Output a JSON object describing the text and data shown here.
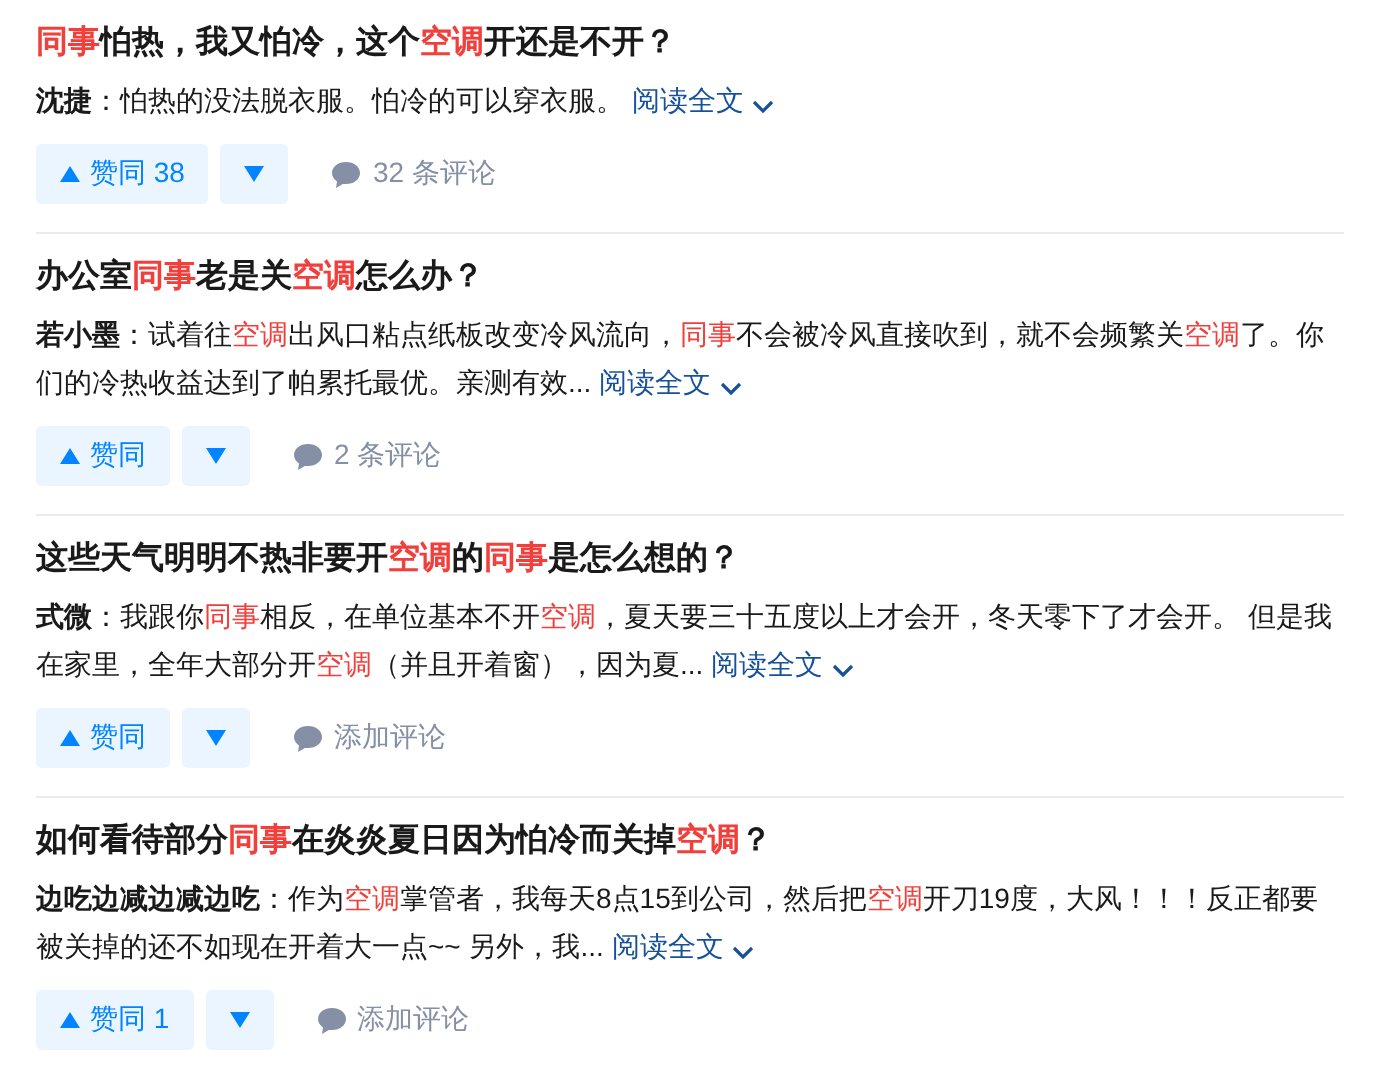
{
  "items": [
    {
      "title": [
        {
          "text": "同事",
          "highlight": true
        },
        {
          "text": "怕热，我又怕冷，这个",
          "highlight": false
        },
        {
          "text": "空调",
          "highlight": true
        },
        {
          "text": "开还是不开？",
          "highlight": false
        }
      ],
      "author": "沈捷",
      "excerpt": [
        {
          "text": "：怕热的没法脱衣服。怕冷的可以穿衣服。",
          "highlight": false
        }
      ],
      "read_more": "阅读全文",
      "vote_label": "赞同",
      "vote_count": "38",
      "comments": "32 条评论"
    },
    {
      "title": [
        {
          "text": "办公室",
          "highlight": false
        },
        {
          "text": "同事",
          "highlight": true
        },
        {
          "text": "老是关",
          "highlight": false
        },
        {
          "text": "空调",
          "highlight": true
        },
        {
          "text": "怎么办？",
          "highlight": false
        }
      ],
      "author": "若小墨",
      "excerpt": [
        {
          "text": "：试着往",
          "highlight": false
        },
        {
          "text": "空调",
          "highlight": true
        },
        {
          "text": "出风口粘点纸板改变冷风流向，",
          "highlight": false
        },
        {
          "text": "同事",
          "highlight": true
        },
        {
          "text": "不会被冷风直接吹到，就不会频繁关",
          "highlight": false
        },
        {
          "text": "空调",
          "highlight": true
        },
        {
          "text": "了。你们的冷热收益达到了帕累托最优。亲测有效...",
          "highlight": false
        }
      ],
      "read_more": "阅读全文",
      "vote_label": "赞同",
      "comments": "2 条评论"
    },
    {
      "title": [
        {
          "text": "这些天气明明不热非要开",
          "highlight": false
        },
        {
          "text": "空调",
          "highlight": true
        },
        {
          "text": "的",
          "highlight": false
        },
        {
          "text": "同事",
          "highlight": true
        },
        {
          "text": "是怎么想的？",
          "highlight": false
        }
      ],
      "author": "式微",
      "excerpt": [
        {
          "text": "：我跟你",
          "highlight": false
        },
        {
          "text": "同事",
          "highlight": true
        },
        {
          "text": "相反，在单位基本不开",
          "highlight": false
        },
        {
          "text": "空调",
          "highlight": true
        },
        {
          "text": "，夏天要三十五度以上才会开，冬天零下了才会开。 但是我在家里，全年大部分开",
          "highlight": false
        },
        {
          "text": "空调",
          "highlight": true
        },
        {
          "text": "（并且开着窗），因为夏...",
          "highlight": false
        }
      ],
      "read_more": "阅读全文",
      "vote_label": "赞同",
      "comments": "添加评论"
    },
    {
      "title": [
        {
          "text": "如何看待部分",
          "highlight": false
        },
        {
          "text": "同事",
          "highlight": true
        },
        {
          "text": "在炎炎夏日因为怕冷而关掉",
          "highlight": false
        },
        {
          "text": "空调",
          "highlight": true
        },
        {
          "text": "？",
          "highlight": false
        }
      ],
      "author": "边吃边减边减边吃",
      "excerpt": [
        {
          "text": "：作为",
          "highlight": false
        },
        {
          "text": "空调",
          "highlight": true
        },
        {
          "text": "掌管者，我每天8点15到公司，然后把",
          "highlight": false
        },
        {
          "text": "空调",
          "highlight": true
        },
        {
          "text": "开刀19度，大风！！！反正都要被关掉的还不如现在开着大一点~~ 另外，我...",
          "highlight": false
        }
      ],
      "read_more": "阅读全文",
      "vote_label": "赞同",
      "vote_count": "1",
      "comments": "添加评论"
    }
  ]
}
